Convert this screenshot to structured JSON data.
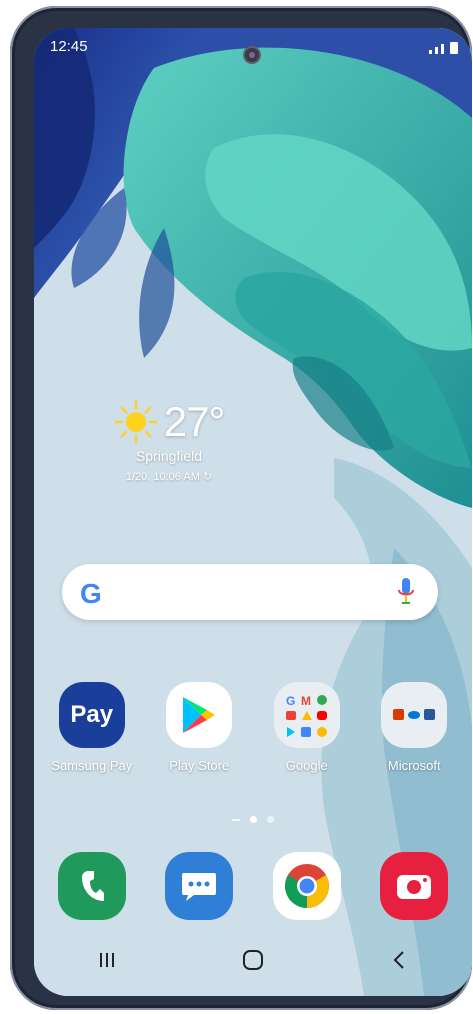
{
  "status_bar": {
    "time": "12:45"
  },
  "weather": {
    "temperature": "27°",
    "city": "Springfield",
    "updated": "1/20, 10:06 AM"
  },
  "search": {
    "logo": "G"
  },
  "apps": [
    {
      "label": "Samsung Pay",
      "icon": "samsung-pay-icon",
      "text": "Pay"
    },
    {
      "label": "Play Store",
      "icon": "play-store-icon"
    },
    {
      "label": "Google",
      "icon": "google-folder-icon"
    },
    {
      "label": "Microsoft",
      "icon": "microsoft-folder-icon"
    }
  ],
  "dock": [
    {
      "icon": "phone-icon"
    },
    {
      "icon": "messages-icon"
    },
    {
      "icon": "chrome-icon"
    },
    {
      "icon": "camera-icon"
    }
  ],
  "navigation": {
    "recent": "recent-apps-icon",
    "home": "home-icon",
    "back": "back-icon"
  },
  "colors": {
    "pay_blue": "#1a3f9a",
    "phone_green": "#1f9a5a",
    "messages_blue": "#2f7fd6",
    "camera_red": "#e8203f",
    "wallpaper_teal": "#3fb3a8"
  }
}
